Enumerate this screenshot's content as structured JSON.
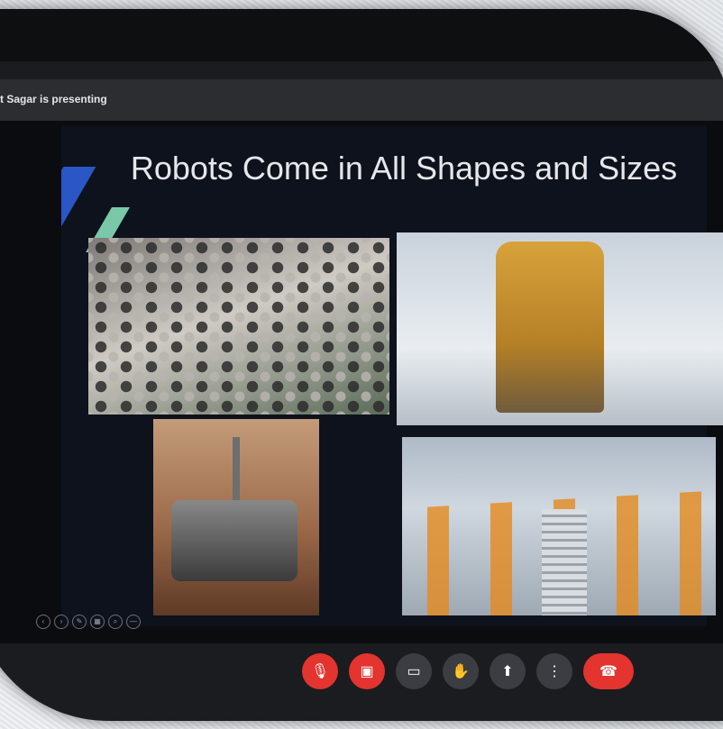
{
  "presenting_text": "t Sagar is presenting",
  "slide": {
    "title": "Robots Come in All Shapes and Sizes"
  },
  "slide_controls": [
    "‹",
    "›",
    "✎",
    "▦",
    "⌕",
    "—"
  ],
  "controls": {
    "mic": "🎙",
    "camera": "▣",
    "captions": "▭",
    "hand": "✋",
    "present": "⬆",
    "more": "⋮",
    "end_call": "☎"
  },
  "colors": {
    "red": "#e3342f",
    "slide_bg": "#0d121c",
    "accent_blue": "#2a56c6",
    "accent_green": "#79c9a9"
  }
}
